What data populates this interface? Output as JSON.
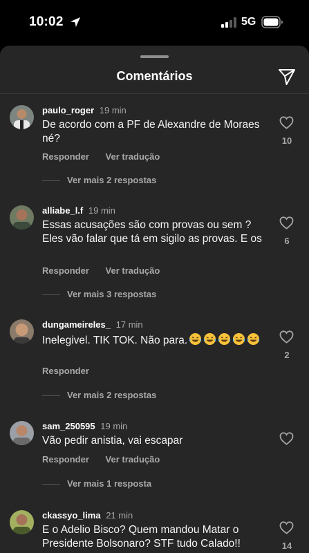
{
  "status_bar": {
    "time": "10:02",
    "network": "5G"
  },
  "sheet": {
    "title": "Comentários"
  },
  "comments": [
    {
      "user": "paulo_roger",
      "time": "19 min",
      "text": "De acordo com a PF de Alexandre de Moraes né?",
      "reply_label": "Responder",
      "translate_label": "Ver tradução",
      "likes": "10",
      "more_replies": "Ver mais 2 respostas"
    },
    {
      "user": "alliabe_l.f",
      "time": "19 min",
      "text": "Essas acusações são com provas ou sem ? Eles vão falar que tá em sigilo as provas. E os",
      "reply_label": "Responder",
      "translate_label": "Ver tradução",
      "likes": "6",
      "more_replies": "Ver mais 3 respostas"
    },
    {
      "user": "dungameireles_",
      "time": "17 min",
      "text": "Inelegivel. TIK TOK. Não para.",
      "reply_label": "Responder",
      "likes": "2",
      "more_replies": "Ver mais 2 respostas"
    },
    {
      "user": "sam_250595",
      "time": "19 min",
      "text": "Vão pedir anistia, vai escapar",
      "reply_label": "Responder",
      "translate_label": "Ver tradução",
      "more_replies": "Ver mais 1 resposta"
    },
    {
      "user": "ckassyo_lima",
      "time": "21 min",
      "text": "E o Adelio Bisco? Quem mandou Matar o Presidente Bolsonaro? STF tudo Calado!!",
      "likes": "14"
    }
  ]
}
